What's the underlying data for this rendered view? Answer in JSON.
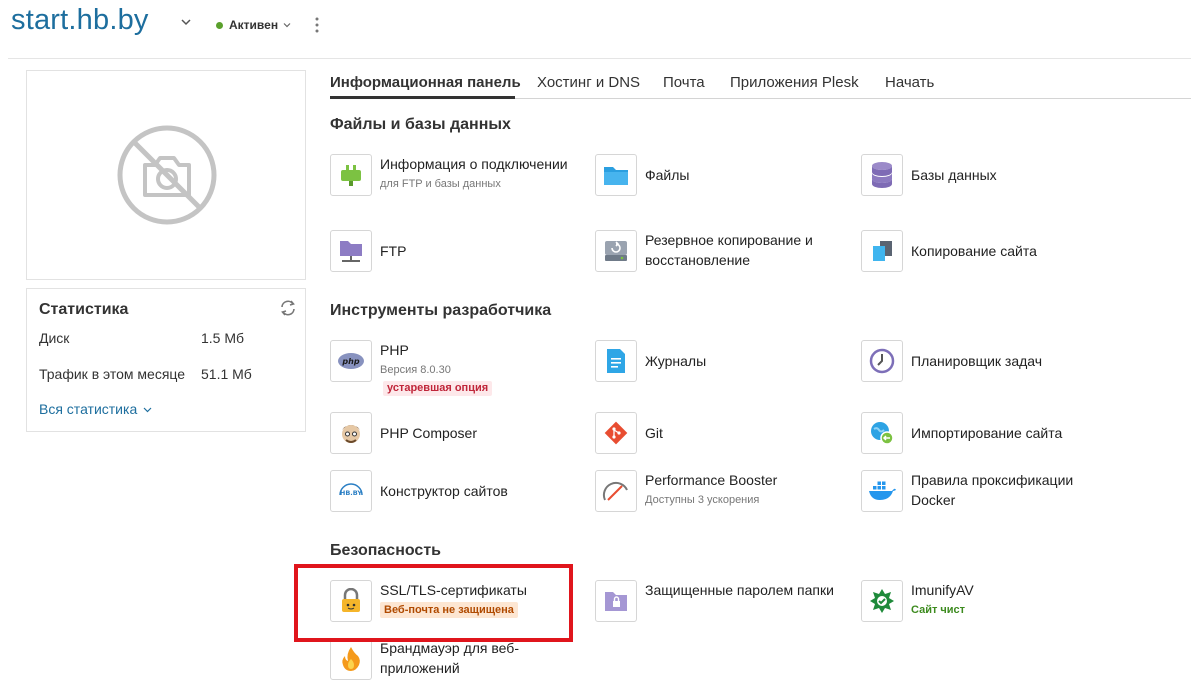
{
  "header": {
    "site_title": "start.hb.by",
    "status_label": "Активен",
    "colors": {
      "brand": "#1d6e9e",
      "status_ok": "#5aa02c",
      "highlight": "#e0151c"
    }
  },
  "sidebar": {
    "screenshot_icon": "no-photo-icon",
    "stats": {
      "title": "Статистика",
      "disk_label": "Диск",
      "disk_value": "1.5 Мб",
      "traffic_label": "Трафик в этом месяце",
      "traffic_value": "51.1 Мб",
      "all_stats_link": "Вся статистика"
    }
  },
  "tabs": [
    {
      "label": "Информационная панель",
      "active": true
    },
    {
      "label": "Хостинг и DNS",
      "active": false
    },
    {
      "label": "Почта",
      "active": false
    },
    {
      "label": "Приложения Plesk",
      "active": false
    },
    {
      "label": "Начать",
      "active": false
    }
  ],
  "sections": {
    "files": {
      "title": "Файлы и базы данных",
      "items": [
        {
          "name": "Информация о подключении",
          "sub": "для FTP и базы данных",
          "icon": "plug-icon"
        },
        {
          "name": "Файлы",
          "icon": "folder-icon"
        },
        {
          "name": "Базы данных",
          "icon": "database-icon"
        },
        {
          "name": "FTP",
          "icon": "ftp-folder-icon"
        },
        {
          "name": "Резервное копирование и восстановление",
          "icon": "backup-icon"
        },
        {
          "name": "Копирование сайта",
          "icon": "copy-site-icon"
        }
      ]
    },
    "dev": {
      "title": "Инструменты разработчика",
      "items": [
        {
          "name": "PHP",
          "sub": "Версия 8.0.30",
          "badge": "устаревшая опция",
          "icon": "php-icon"
        },
        {
          "name": "Журналы",
          "icon": "logs-icon"
        },
        {
          "name": "Планировщик задач",
          "icon": "clock-icon"
        },
        {
          "name": "PHP Composer",
          "icon": "composer-icon"
        },
        {
          "name": "Git",
          "icon": "git-icon"
        },
        {
          "name": "Импортирование сайта",
          "icon": "import-site-icon"
        },
        {
          "name": "Конструктор сайтов",
          "icon": "site-builder-icon",
          "icon_text": "HB.BY"
        },
        {
          "name": "Performance Booster",
          "sub": "Доступны 3 ускорения",
          "icon": "gauge-icon"
        },
        {
          "name": "Правила проксификации Docker",
          "icon": "docker-icon"
        }
      ]
    },
    "security": {
      "title": "Безопасность",
      "items": [
        {
          "name": "SSL/TLS-сертификаты",
          "badge": "Веб-почта не защищена",
          "icon": "lock-icon"
        },
        {
          "name": "Защищенные паролем папки",
          "icon": "protected-folder-icon"
        },
        {
          "name": "ImunifyAV",
          "sub": "Сайт чист",
          "icon": "imunify-icon"
        },
        {
          "name": "Брандмауэр для веб-приложений",
          "icon": "flame-icon"
        }
      ]
    }
  }
}
